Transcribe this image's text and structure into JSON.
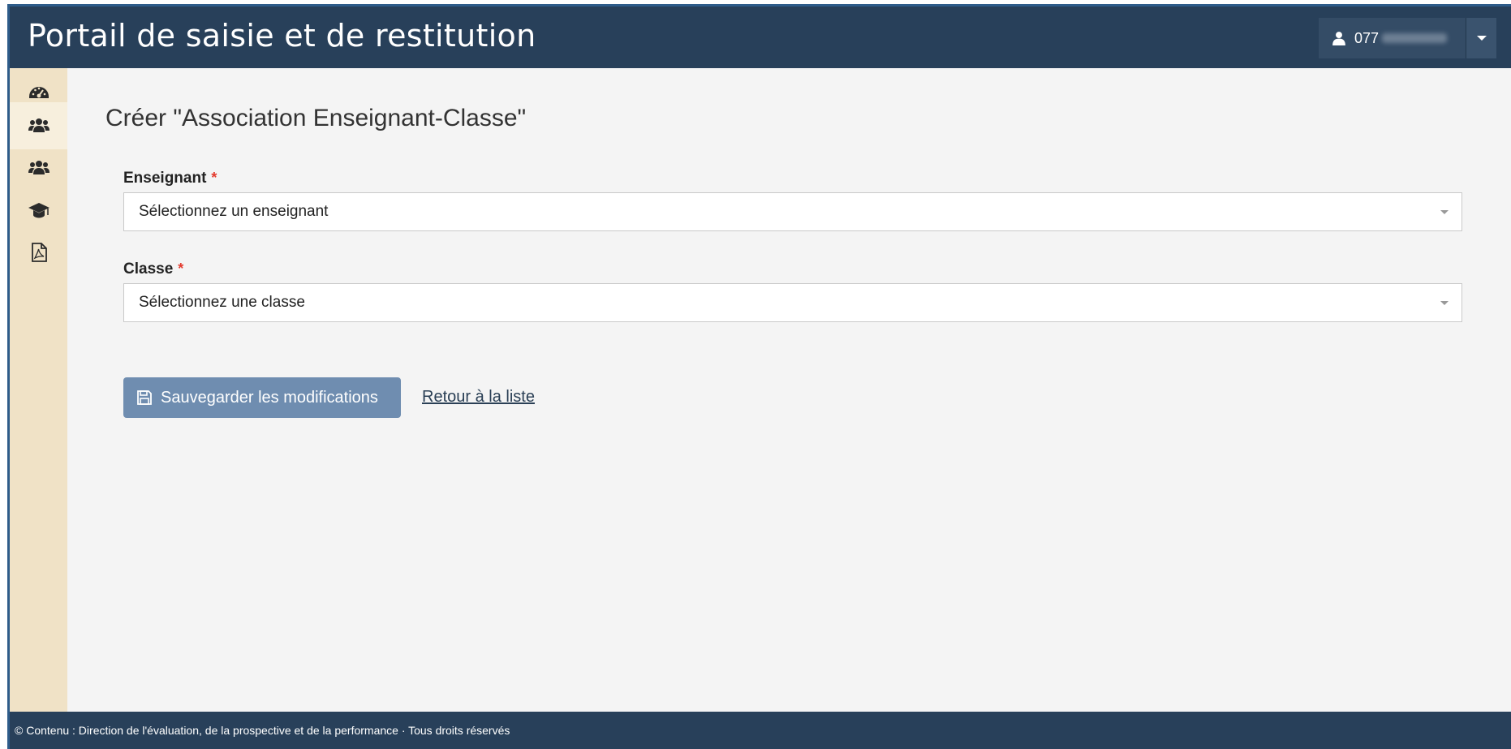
{
  "header": {
    "title": "Portail de saisie et de restitution",
    "user_id": "077",
    "user_icon": "user-icon",
    "dropdown_icon": "caret-down-icon"
  },
  "sidebar": {
    "items": [
      {
        "icon": "dashboard-icon",
        "active": false
      },
      {
        "icon": "users-icon",
        "active": true
      },
      {
        "icon": "users-icon",
        "active": false
      },
      {
        "icon": "graduation-cap-icon",
        "active": false
      },
      {
        "icon": "pdf-file-icon",
        "active": false
      }
    ]
  },
  "main": {
    "page_title": "Créer \"Association Enseignant-Classe\"",
    "fields": {
      "enseignant": {
        "label": "Enseignant",
        "required_mark": "*",
        "value": "Sélectionnez un enseignant"
      },
      "classe": {
        "label": "Classe",
        "required_mark": "*",
        "value": "Sélectionnez une classe"
      }
    },
    "save_button": "Sauvegarder les modifications",
    "back_link": "Retour à la liste"
  },
  "footer": {
    "text": "© Contenu : Direction de l'évaluation, de la prospective et de la performance · Tous droits réservés"
  },
  "colors": {
    "header_bg": "#28405a",
    "sidebar_bg": "#f0e2c6",
    "primary_button": "#6f8db0",
    "required": "#e33b2e"
  }
}
